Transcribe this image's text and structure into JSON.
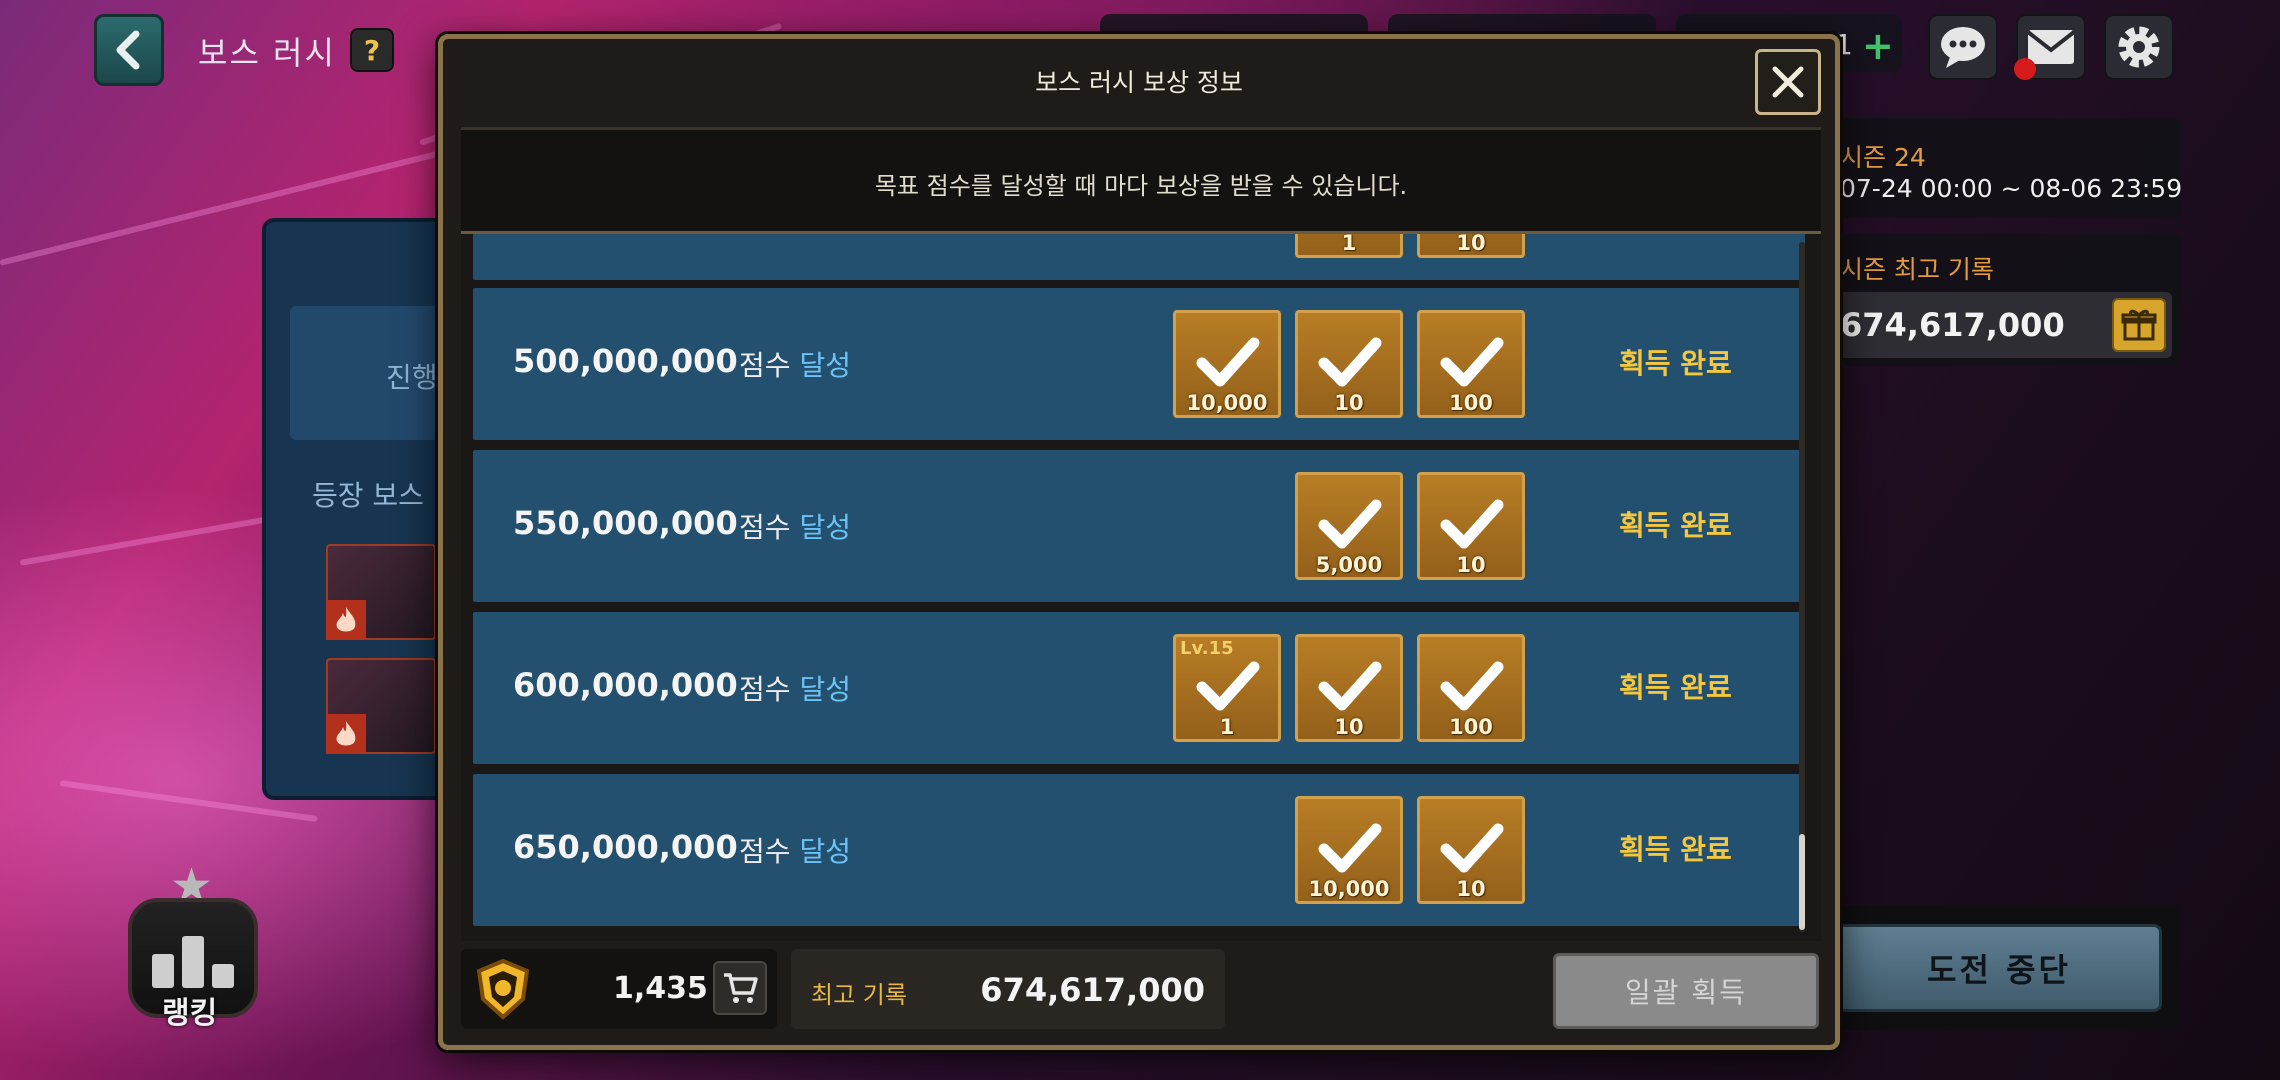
{
  "header": {
    "title": "보스 러시",
    "help_label": "?",
    "currency_count_partial": "1"
  },
  "side_info": {
    "season_label": "시즌 24",
    "season_period": "07-24 00:00 ~ 08-06 23:59",
    "best_label": "시즌 최고 기록",
    "best_value": "674,617,000",
    "quit_label": "도전 중단"
  },
  "left_panel": {
    "tab_label": "진행",
    "boss_section_label": "등장 보스",
    "ranking_label": "랭킹"
  },
  "modal": {
    "title": "보스 러시 보상 정보",
    "notice": "목표 점수를 달성할 때 마다 보상을 받을 수 있습니다.",
    "suffix_score": "점수",
    "suffix_achieve": "달성",
    "partial_row_rewards": [
      "1",
      "10"
    ],
    "rows": [
      {
        "score": "500,000,000",
        "status": "획득 완료",
        "rewards": [
          {
            "qty": "10,000"
          },
          {
            "qty": "10"
          },
          {
            "qty": "100"
          }
        ]
      },
      {
        "score": "550,000,000",
        "status": "획득 완료",
        "rewards": [
          {
            "qty": "5,000"
          },
          {
            "qty": "10"
          }
        ]
      },
      {
        "score": "600,000,000",
        "status": "획득 완료",
        "rewards": [
          {
            "qty": "1",
            "level": "Lv.15"
          },
          {
            "qty": "10"
          },
          {
            "qty": "100"
          }
        ]
      },
      {
        "score": "650,000,000",
        "status": "획득 완료",
        "rewards": [
          {
            "qty": "10,000"
          },
          {
            "qty": "10"
          }
        ]
      }
    ],
    "footer": {
      "medal_count": "1,435",
      "record_label": "최고 기록",
      "record_value": "674,617,000",
      "claim_all_label": "일괄 획득"
    }
  },
  "icons": {
    "back": "chevron-left-icon",
    "chat": "chat-bubble-icon",
    "mail": "mail-icon",
    "settings": "gear-icon",
    "close": "close-icon",
    "gift": "gift-icon",
    "shop": "cart-icon",
    "medal": "shield-medal-icon",
    "check": "check-icon",
    "fire": "fire-icon"
  },
  "colors": {
    "row_bg": "#23506f",
    "status_gold": "#f4c73e",
    "achieve_blue": "#6cc2f4",
    "modal_border": "#8a734b"
  }
}
